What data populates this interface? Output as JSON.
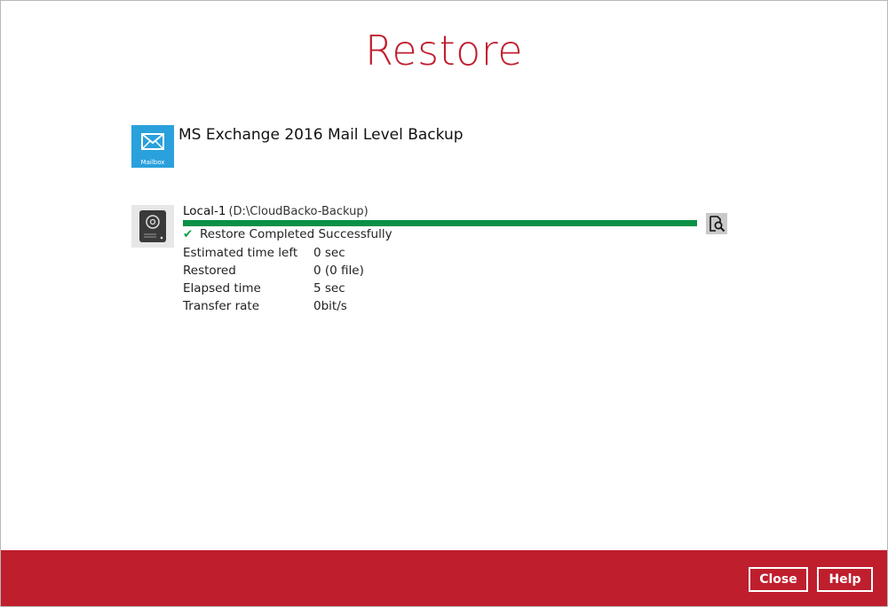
{
  "page": {
    "title": "Restore"
  },
  "backup_set": {
    "icon": "mailbox-icon",
    "tile_label": "Mailbox",
    "name": "MS Exchange 2016 Mail Level Backup",
    "tile_color": "#2aa1dc"
  },
  "destination": {
    "icon": "hard-drive-icon",
    "name": "Local-1",
    "path": "(D:\\CloudBacko-Backup)",
    "progress_fraction": 1.0,
    "status": "Restore Completed Successfully",
    "status_icon": "checkmark-icon",
    "stats": [
      {
        "label": "Estimated time left",
        "value": "0 sec"
      },
      {
        "label": "Restored",
        "value": "0 (0 file)"
      },
      {
        "label": "Elapsed time",
        "value": "5 sec"
      },
      {
        "label": "Transfer rate",
        "value": "0bit/s"
      }
    ],
    "report_icon": "view-report-icon"
  },
  "footer": {
    "close_label": "Close",
    "help_label": "Help",
    "color": "#bf1e2d"
  },
  "colors": {
    "accent": "#c01f2f",
    "progress": "#0a9146",
    "success": "#12a051"
  }
}
